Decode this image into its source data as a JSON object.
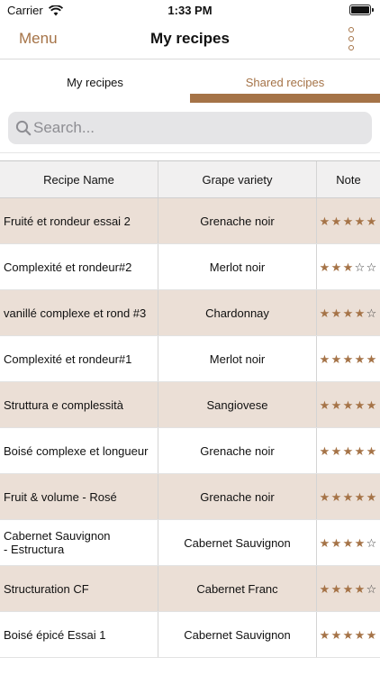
{
  "status_bar": {
    "carrier": "Carrier",
    "time": "1:33 PM"
  },
  "nav": {
    "left_label": "Menu",
    "title": "My recipes",
    "more_icon": "kebab-vertical-icon"
  },
  "tabs": [
    {
      "label": "My recipes",
      "selected": false
    },
    {
      "label": "Shared recipes",
      "selected": true
    }
  ],
  "search": {
    "placeholder": "Search...",
    "value": ""
  },
  "colors": {
    "accent": "#a57347",
    "row_alt": "#ebdfd6",
    "star_filled": "#a57347"
  },
  "table": {
    "headers": [
      "Recipe Name",
      "Grape variety",
      "Note"
    ],
    "rows": [
      {
        "name": "Fruité et rondeur essai 2",
        "grape": "Grenache noir",
        "rating": 5
      },
      {
        "name": "Complexité et rondeur#2",
        "grape": "Merlot noir",
        "rating": 3
      },
      {
        "name": "vanillé complexe et rond #3",
        "grape": "Chardonnay",
        "rating": 4
      },
      {
        "name": "Complexité et rondeur#1",
        "grape": "Merlot noir",
        "rating": 5
      },
      {
        "name": "Struttura e complessità",
        "grape": "Sangiovese",
        "rating": 5
      },
      {
        "name": "Boisé complexe et longueur",
        "grape": "Grenache noir",
        "rating": 5
      },
      {
        "name": "Fruit & volume - Rosé",
        "grape": "Grenache noir",
        "rating": 5
      },
      {
        "name": "Cabernet Sauvignon\n - Estructura",
        "grape": "Cabernet Sauvignon",
        "rating": 4
      },
      {
        "name": "Structuration CF",
        "grape": "Cabernet Franc",
        "rating": 4
      },
      {
        "name": "Boisé épicé Essai 1",
        "grape": "Cabernet Sauvignon",
        "rating": 5
      }
    ],
    "max_rating": 5
  }
}
